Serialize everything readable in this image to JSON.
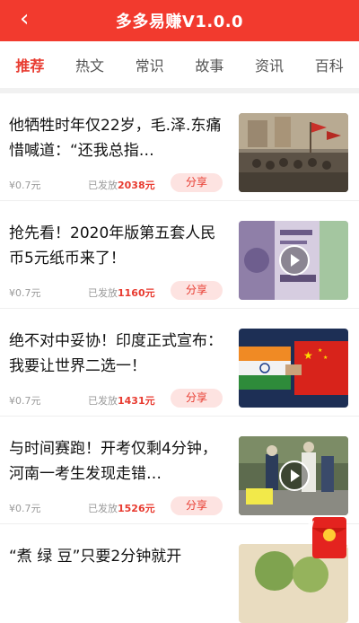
{
  "header": {
    "title": "多多易赚V1.0.0",
    "back_icon": "chevron-left-icon",
    "bg_color": "#f23a2e"
  },
  "tabs": [
    {
      "label": "推荐",
      "active": true
    },
    {
      "label": "热文",
      "active": false
    },
    {
      "label": "常识",
      "active": false
    },
    {
      "label": "故事",
      "active": false
    },
    {
      "label": "资讯",
      "active": false
    },
    {
      "label": "百科",
      "active": false
    }
  ],
  "articles": [
    {
      "title": "他牺牲时年仅22岁，毛.泽.东痛惜喊道：“还我总指…",
      "price": "¥0.7元",
      "issued_label": "已发放",
      "issued_amount": "2038元",
      "share_label": "分享",
      "video": false
    },
    {
      "title": "抢先看！2020年版第五套人民币5元纸币来了！",
      "price": "¥0.7元",
      "issued_label": "已发放",
      "issued_amount": "1160元",
      "share_label": "分享",
      "video": true
    },
    {
      "title": "绝不对中妥协！印度正式宣布：我要让世界二选一！",
      "price": "¥0.7元",
      "issued_label": "已发放",
      "issued_amount": "1431元",
      "share_label": "分享",
      "video": false
    },
    {
      "title": "与时间赛跑！开考仅剩4分钟，河南一考生发现走错…",
      "price": "¥0.7元",
      "issued_label": "已发放",
      "issued_amount": "1526元",
      "share_label": "分享",
      "video": true
    },
    {
      "title": "“煮 绿 豆”只要2分钟就开",
      "video": false
    }
  ],
  "floating": {
    "icon": "red-envelope-icon"
  },
  "colors": {
    "accent": "#e83b30",
    "share_bg": "#fde3e1"
  }
}
